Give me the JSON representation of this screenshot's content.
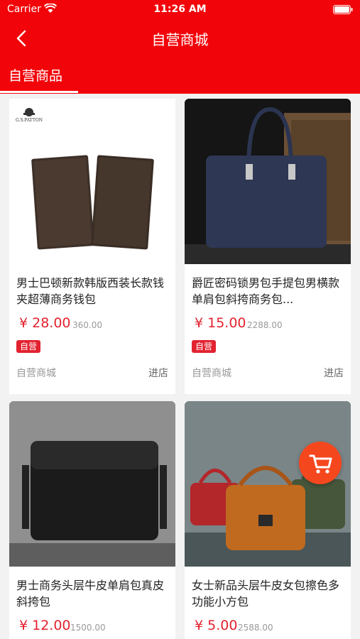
{
  "status_bar": {
    "carrier": "Carrier",
    "time": "11:26 AM"
  },
  "nav": {
    "title": "自营商城",
    "back_icon": "chevron-left-icon"
  },
  "tabs": [
    {
      "label": "自营商品",
      "active": true
    }
  ],
  "colors": {
    "primary": "#f2050a",
    "price": "#e2222f",
    "cart": "#f5471e"
  },
  "products": [
    {
      "name": "男士巴顿新款韩版西装长款钱夹超薄商务钱包",
      "price": "¥ 28.00",
      "original_price": "360.00",
      "badge": "自营",
      "shop": "自营商城",
      "enter": "进店",
      "image_brand": "G.S.PATTON"
    },
    {
      "name": "爵匠密码锁男包手提包男横款单肩包斜挎商务包...",
      "price": "¥ 15.00",
      "original_price": "2288.00",
      "badge": "自营",
      "shop": "自营商城",
      "enter": "进店"
    },
    {
      "name": "男士商务头层牛皮单肩包真皮斜挎包",
      "price": "¥ 12.00",
      "original_price": "1500.00"
    },
    {
      "name": "女士新品头层牛皮女包擦色多功能小方包",
      "price": "¥ 5.00",
      "original_price": "2588.00"
    }
  ],
  "cart_icon": "shopping-cart-icon"
}
